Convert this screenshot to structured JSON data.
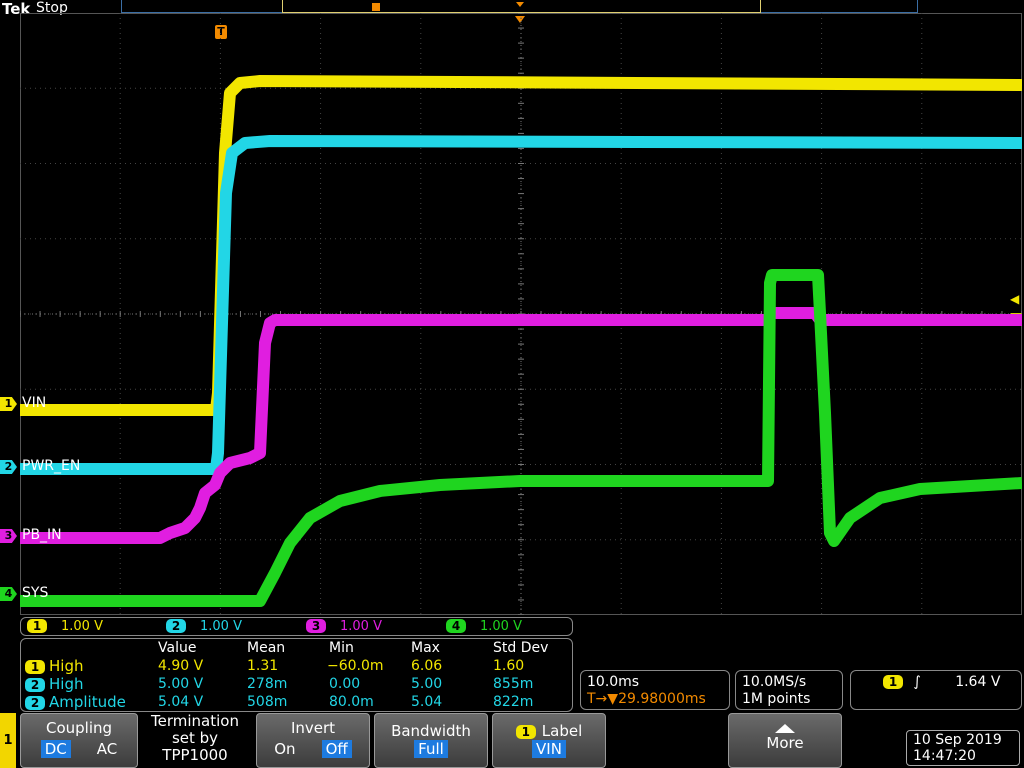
{
  "header": {
    "brand": "Tek",
    "state": "Stop"
  },
  "channels": [
    {
      "num": "1",
      "name": "VIN",
      "color": "#f2e600",
      "scale": "1.00 V"
    },
    {
      "num": "2",
      "name": "PWR_EN",
      "color": "#22d6e6",
      "scale": "1.00 V"
    },
    {
      "num": "3",
      "name": "PB_IN",
      "color": "#e01ee0",
      "scale": "1.00 V"
    },
    {
      "num": "4",
      "name": "SYS",
      "color": "#1fd51f",
      "scale": "1.00 V"
    }
  ],
  "trigger_marker": "T",
  "measurements": {
    "headers": [
      "Value",
      "Mean",
      "Min",
      "Max",
      "Std Dev"
    ],
    "rows": [
      {
        "ch": "1",
        "name": "High",
        "value": "4.90 V",
        "mean": "1.31",
        "min": "−60.0m",
        "max": "6.06",
        "std": "1.60"
      },
      {
        "ch": "2",
        "name": "High",
        "value": "5.00 V",
        "mean": "278m",
        "min": "0.00",
        "max": "5.00",
        "std": "855m"
      },
      {
        "ch": "2",
        "name": "Amplitude",
        "value": "5.04 V",
        "mean": "508m",
        "min": "80.0m",
        "max": "5.04",
        "std": "822m"
      }
    ]
  },
  "timebase": {
    "scale": "10.0ms",
    "delay": "29.98000ms",
    "delay_prefix": "T→▼"
  },
  "acquisition": {
    "rate": "10.0MS/s",
    "points": "1M points"
  },
  "trigger": {
    "ch": "1",
    "slope": "∫",
    "level": "1.64 V"
  },
  "menu": {
    "softkey_ch": "1",
    "coupling": {
      "title": "Coupling",
      "dc": "DC",
      "ac": "AC"
    },
    "termination": {
      "line1": "Termination",
      "line2": "set by",
      "line3": "TPP1000"
    },
    "invert": {
      "title": "Invert",
      "on": "On",
      "off": "Off"
    },
    "bandwidth": {
      "title": "Bandwidth",
      "value": "Full"
    },
    "label": {
      "ch": "1",
      "title": "Label",
      "value": "VIN"
    },
    "more": {
      "title": "More"
    }
  },
  "datetime": {
    "date": "10 Sep  2019",
    "time": "14:47:20"
  }
}
